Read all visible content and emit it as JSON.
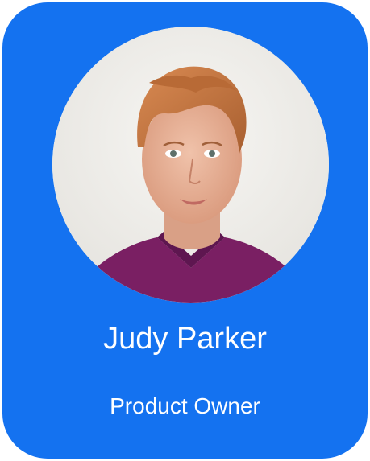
{
  "profile": {
    "name": "Judy Parker",
    "title": "Product Owner",
    "photo_icon": "portrait-photo"
  },
  "colors": {
    "card_background": "#1472f0",
    "text": "#ffffff",
    "photo_background": "#f0efeb",
    "hair": "#c8763f",
    "skin": "#e6b096",
    "shirt": "#7a1f63"
  }
}
